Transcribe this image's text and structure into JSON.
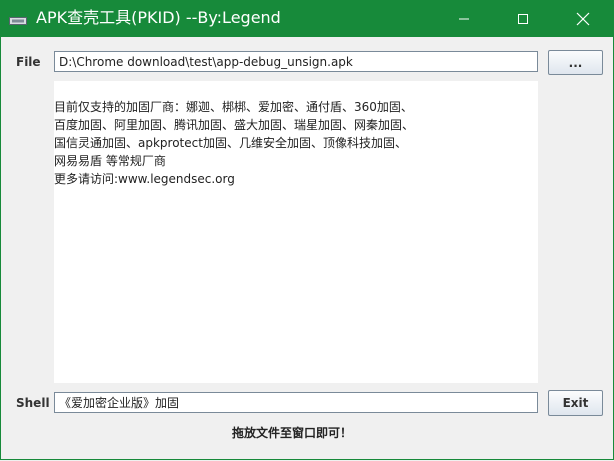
{
  "window": {
    "title": "APK查壳工具(PKID) --By:Legend",
    "accent_color": "#178a3a",
    "icons": {
      "app": "app-icon",
      "minimize": "minimize-icon",
      "maximize": "maximize-icon",
      "close": "close-icon"
    }
  },
  "file_row": {
    "label": "File",
    "value": "D:\\Chrome download\\test\\app-debug_unsign.apk",
    "browse_label": "..."
  },
  "info": {
    "lines": [
      "目前仅支持的加固厂商：娜迦、梆梆、爱加密、通付盾、360加固、",
      "百度加固、阿里加固、腾讯加固、盛大加固、瑞星加固、网秦加固、",
      "国信灵通加固、apkprotect加固、几维安全加固、顶像科技加固、",
      "网易易盾 等常规厂商",
      "更多请访问:www.legendsec.org"
    ]
  },
  "shell_row": {
    "label": "Shell",
    "value": "《爱加密企业版》加固",
    "exit_label": "Exit"
  },
  "hint": "拖放文件至窗口即可！"
}
